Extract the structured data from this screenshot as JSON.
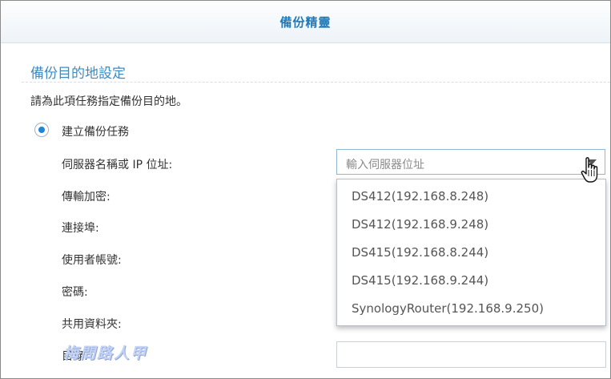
{
  "window": {
    "title": "備份精靈"
  },
  "section": {
    "title": "備份目的地設定",
    "description": "請為此項任務指定備份目的地。"
  },
  "radio": {
    "label": "建立備份任務",
    "selected": true
  },
  "fields": {
    "server": "伺服器名稱或 IP 位址:",
    "encryption": "傳輸加密:",
    "port": "連接埠:",
    "username": "使用者帳號:",
    "password": "密碼:",
    "shared_folder": "共用資料夾:",
    "directory": "目錄:"
  },
  "server_input": {
    "placeholder": "輸入伺服器位址"
  },
  "dropdown": {
    "items": [
      "DS412(192.168.8.248)",
      "DS412(192.168.9.248)",
      "DS415(192.168.8.244)",
      "DS415(192.168.9.244)",
      "SynologyRouter(192.168.9.250)"
    ]
  },
  "watermark": "梅問路人甲",
  "colors": {
    "accent": "#2379b5",
    "radio": "#1f86d3",
    "input_border": "#8fb7d6"
  },
  "icons": {
    "dropdown": "chevron-down-icon",
    "cursor": "hand-pointer-icon"
  }
}
